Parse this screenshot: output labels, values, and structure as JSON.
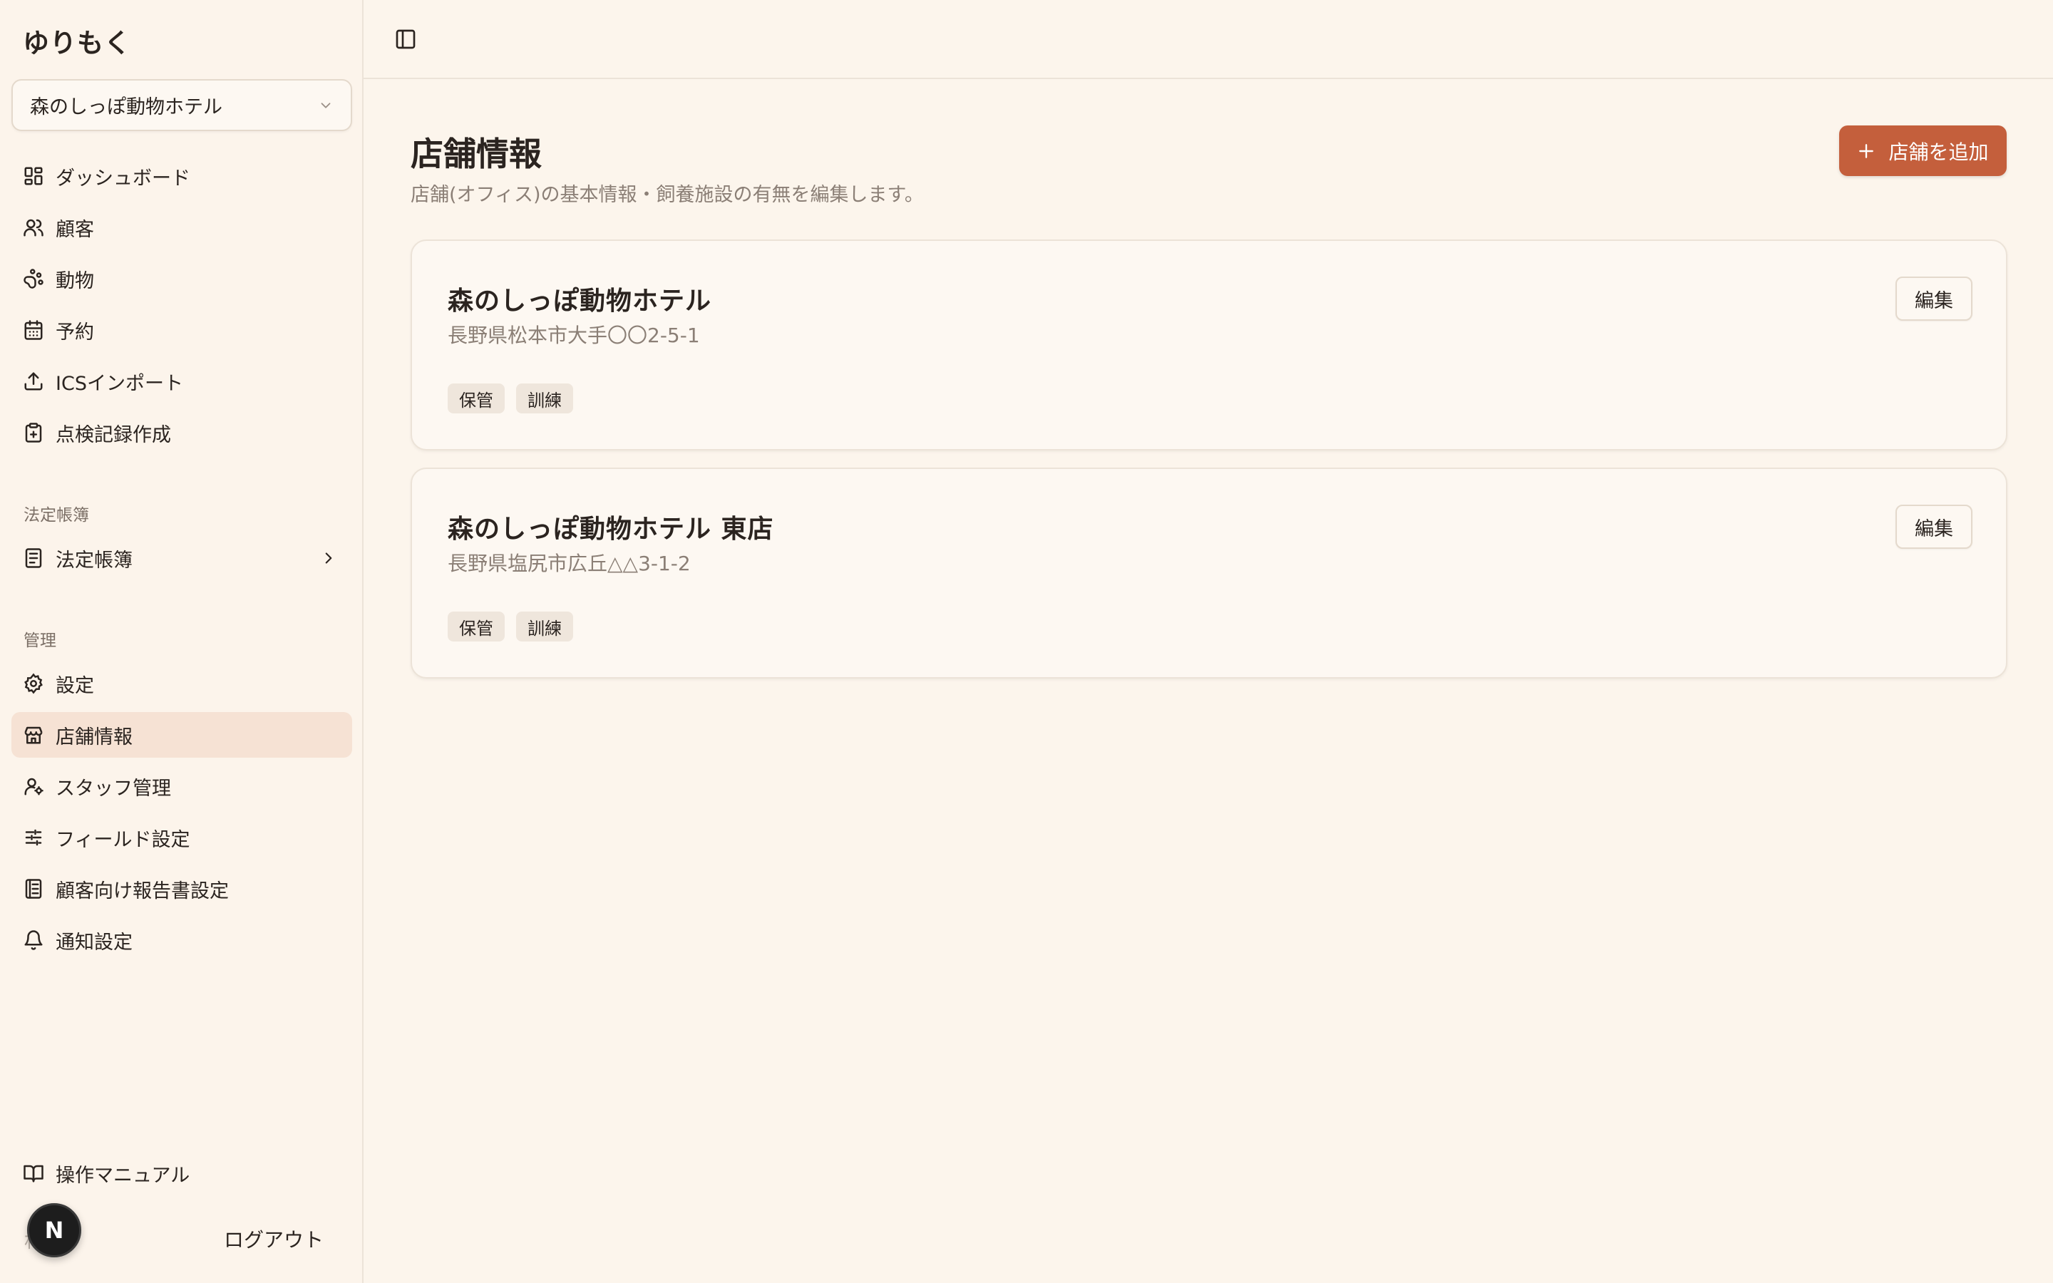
{
  "sidebar": {
    "brand": "ゆりもく",
    "store_select": "森のしっぽ動物ホテル",
    "main_items": [
      {
        "label": "ダッシュボード",
        "icon": "dashboard-icon"
      },
      {
        "label": "顧客",
        "icon": "users-icon"
      },
      {
        "label": "動物",
        "icon": "paw-icon"
      },
      {
        "label": "予約",
        "icon": "calendar-icon"
      },
      {
        "label": "ICSインポート",
        "icon": "upload-icon"
      },
      {
        "label": "点検記録作成",
        "icon": "clipboard-icon"
      }
    ],
    "ledger_section": "法定帳簿",
    "ledger_item": "法定帳簿",
    "admin_section": "管理",
    "admin_items": [
      {
        "label": "設定",
        "icon": "gear-icon"
      },
      {
        "label": "店舗情報",
        "icon": "store-icon",
        "active": true
      },
      {
        "label": "スタッフ管理",
        "icon": "user-gear-icon"
      },
      {
        "label": "フィールド設定",
        "icon": "sliders-icon"
      },
      {
        "label": "顧客向け報告書設定",
        "icon": "report-icon"
      },
      {
        "label": "通知設定",
        "icon": "bell-icon"
      }
    ],
    "manual": "操作マニュアル",
    "avatar_letter": "N",
    "user_name": "林 輝",
    "logout": "ログアウト"
  },
  "main": {
    "title": "店舗情報",
    "description": "店舗(オフィス)の基本情報・飼養施設の有無を編集します。",
    "add_button": "店舗を追加",
    "stores": [
      {
        "name": "森のしっぽ動物ホテル",
        "address": "長野県松本市大手〇〇2-5-1",
        "tags": [
          "保管",
          "訓練"
        ],
        "edit": "編集"
      },
      {
        "name": "森のしっぽ動物ホテル 東店",
        "address": "長野県塩尻市広丘△△3-1-2",
        "tags": [
          "保管",
          "訓練"
        ],
        "edit": "編集"
      }
    ]
  },
  "colors": {
    "background": "#fcf5ec",
    "accent": "#c45f3c",
    "active_nav": "#f6e2d4"
  }
}
